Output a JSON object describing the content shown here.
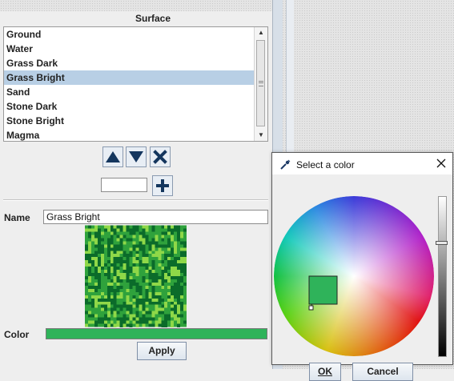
{
  "surface_panel": {
    "title": "Surface",
    "items": [
      {
        "label": "Ground"
      },
      {
        "label": "Water"
      },
      {
        "label": "Grass Dark"
      },
      {
        "label": "Grass Bright",
        "selected": true
      },
      {
        "label": "Sand"
      },
      {
        "label": "Stone Dark"
      },
      {
        "label": "Stone Bright"
      },
      {
        "label": "Magma"
      }
    ],
    "move_up_icon": "triangle-up-icon",
    "move_down_icon": "triangle-down-icon",
    "delete_icon": "x-icon",
    "add_icon": "plus-icon",
    "new_name_value": ""
  },
  "properties": {
    "name_label": "Name",
    "name_value": "Grass Bright",
    "color_label": "Color",
    "color_value": "#2fb35a",
    "apply_label": "Apply"
  },
  "color_dialog": {
    "title": "Select a color",
    "ok_label": "OK",
    "cancel_label": "Cancel",
    "selected_color": "#2fb35a"
  },
  "colors": {
    "button_icon": "#14365e",
    "selection": "#b8cfe5",
    "texture_dark": "#0b6b2a",
    "texture_mid": "#2fa23c",
    "texture_light": "#8fd848"
  }
}
